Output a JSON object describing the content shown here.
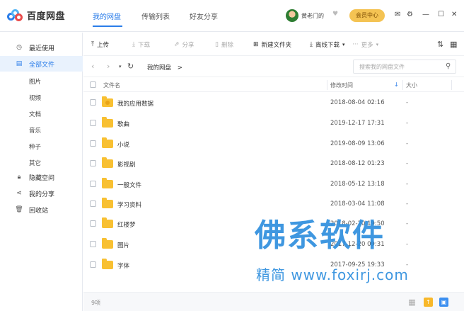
{
  "app": {
    "name": "百度网盘"
  },
  "nav": {
    "tabs": [
      "我的网盘",
      "传输列表",
      "好友分享"
    ],
    "active": 0
  },
  "user": {
    "name": "黄老门的",
    "vip_label": "会员中心"
  },
  "window_controls": [
    "mail-icon",
    "gear-icon",
    "minimize-icon",
    "maximize-icon",
    "close-icon"
  ],
  "sidebar": {
    "items": [
      {
        "label": "最近使用",
        "icon": "clock-icon"
      },
      {
        "label": "全部文件",
        "icon": "file-icon",
        "active": true
      },
      {
        "label": "隐藏空间",
        "icon": "lock-icon"
      },
      {
        "label": "我的分享",
        "icon": "share-icon"
      },
      {
        "label": "回收站",
        "icon": "trash-icon"
      }
    ],
    "sub_items": [
      "图片",
      "视频",
      "文档",
      "音乐",
      "种子",
      "其它"
    ]
  },
  "toolbar": {
    "upload": "上传",
    "download": "下载",
    "share": "分享",
    "delete": "删除",
    "new_folder": "新建文件夹",
    "offline_download": "离线下载",
    "more": "更多"
  },
  "path": {
    "current": "我的网盘",
    "separator": ">"
  },
  "search": {
    "placeholder": "搜索我的网盘文件"
  },
  "columns": {
    "name": "文件名",
    "modified": "修改时间",
    "size": "大小"
  },
  "files": [
    {
      "name": "我的应用数据",
      "date": "2018-08-04 02:16",
      "size": "-"
    },
    {
      "name": "歌曲",
      "date": "2019-12-17 17:31",
      "size": "-"
    },
    {
      "name": "小说",
      "date": "2019-08-09 13:06",
      "size": "-"
    },
    {
      "name": "影视剧",
      "date": "2018-08-12 01:23",
      "size": "-"
    },
    {
      "name": "一般文件",
      "date": "2018-05-12 13:18",
      "size": "-"
    },
    {
      "name": "学习资料",
      "date": "2018-03-04 11:08",
      "size": "-"
    },
    {
      "name": "红楼梦",
      "date": "2018-02-20 19:50",
      "size": "-"
    },
    {
      "name": "图片",
      "date": "2017-12-20 09:31",
      "size": "-"
    },
    {
      "name": "字体",
      "date": "2017-09-25 19:33",
      "size": "-"
    }
  ],
  "status": {
    "count": "9项"
  },
  "watermark": {
    "main": "佛系软件",
    "sub": "精简 www.foxirj.com"
  },
  "colors": {
    "accent": "#2b7de9",
    "vip": "#f4c353",
    "folder": "#f8c032"
  }
}
